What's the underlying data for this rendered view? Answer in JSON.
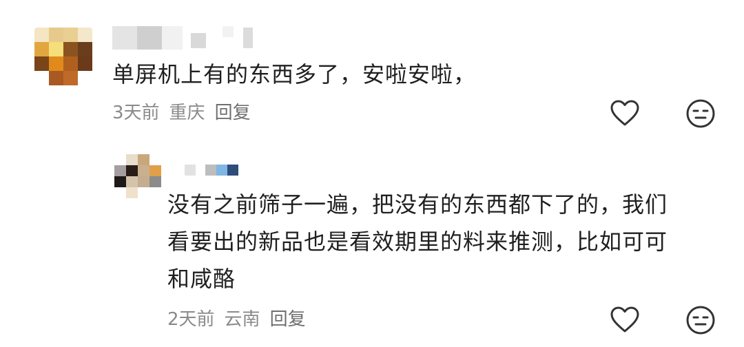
{
  "comments": [
    {
      "avatar_icon": "pixelated-avatar",
      "username_icon": "pixelated-username",
      "text": "单屏机上有的东西多了，安啦安啦，",
      "time": "3天前",
      "location": "重庆",
      "reply_label": "回复",
      "like_icon": "heart-outline-icon",
      "dislike_icon": "meh-face-icon"
    },
    {
      "avatar_icon": "pixelated-avatar",
      "username_icon": "pixelated-username",
      "text_line1": "没有之前筛子一遍，把没有的东西都下了的，我们",
      "text_line2": "看要出的新品也是看效期里的料来推测，比如可可",
      "text_line3": "和咸酪",
      "time": "2天前",
      "location": "云南",
      "reply_label": "回复",
      "like_icon": "heart-outline-icon",
      "dislike_icon": "meh-face-icon"
    }
  ]
}
